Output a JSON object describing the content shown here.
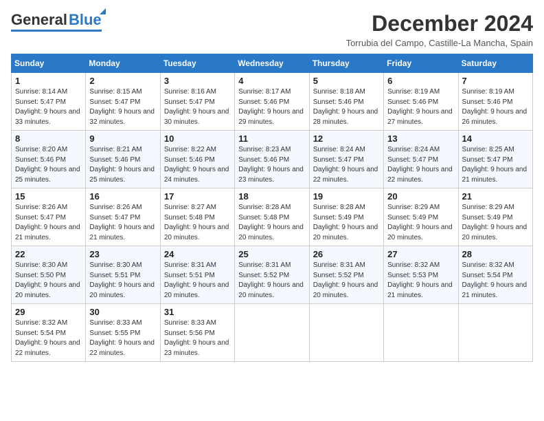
{
  "header": {
    "logo": {
      "general": "General",
      "blue": "Blue"
    },
    "title": "December 2024",
    "subtitle": "Torrubia del Campo, Castille-La Mancha, Spain"
  },
  "weekdays": [
    "Sunday",
    "Monday",
    "Tuesday",
    "Wednesday",
    "Thursday",
    "Friday",
    "Saturday"
  ],
  "weeks": [
    [
      {
        "day": "1",
        "sunrise": "8:14 AM",
        "sunset": "5:47 PM",
        "daylight": "9 hours and 33 minutes."
      },
      {
        "day": "2",
        "sunrise": "8:15 AM",
        "sunset": "5:47 PM",
        "daylight": "9 hours and 32 minutes."
      },
      {
        "day": "3",
        "sunrise": "8:16 AM",
        "sunset": "5:47 PM",
        "daylight": "9 hours and 30 minutes."
      },
      {
        "day": "4",
        "sunrise": "8:17 AM",
        "sunset": "5:46 PM",
        "daylight": "9 hours and 29 minutes."
      },
      {
        "day": "5",
        "sunrise": "8:18 AM",
        "sunset": "5:46 PM",
        "daylight": "9 hours and 28 minutes."
      },
      {
        "day": "6",
        "sunrise": "8:19 AM",
        "sunset": "5:46 PM",
        "daylight": "9 hours and 27 minutes."
      },
      {
        "day": "7",
        "sunrise": "8:19 AM",
        "sunset": "5:46 PM",
        "daylight": "9 hours and 26 minutes."
      }
    ],
    [
      {
        "day": "8",
        "sunrise": "8:20 AM",
        "sunset": "5:46 PM",
        "daylight": "9 hours and 25 minutes."
      },
      {
        "day": "9",
        "sunrise": "8:21 AM",
        "sunset": "5:46 PM",
        "daylight": "9 hours and 25 minutes."
      },
      {
        "day": "10",
        "sunrise": "8:22 AM",
        "sunset": "5:46 PM",
        "daylight": "9 hours and 24 minutes."
      },
      {
        "day": "11",
        "sunrise": "8:23 AM",
        "sunset": "5:46 PM",
        "daylight": "9 hours and 23 minutes."
      },
      {
        "day": "12",
        "sunrise": "8:24 AM",
        "sunset": "5:47 PM",
        "daylight": "9 hours and 22 minutes."
      },
      {
        "day": "13",
        "sunrise": "8:24 AM",
        "sunset": "5:47 PM",
        "daylight": "9 hours and 22 minutes."
      },
      {
        "day": "14",
        "sunrise": "8:25 AM",
        "sunset": "5:47 PM",
        "daylight": "9 hours and 21 minutes."
      }
    ],
    [
      {
        "day": "15",
        "sunrise": "8:26 AM",
        "sunset": "5:47 PM",
        "daylight": "9 hours and 21 minutes."
      },
      {
        "day": "16",
        "sunrise": "8:26 AM",
        "sunset": "5:47 PM",
        "daylight": "9 hours and 21 minutes."
      },
      {
        "day": "17",
        "sunrise": "8:27 AM",
        "sunset": "5:48 PM",
        "daylight": "9 hours and 20 minutes."
      },
      {
        "day": "18",
        "sunrise": "8:28 AM",
        "sunset": "5:48 PM",
        "daylight": "9 hours and 20 minutes."
      },
      {
        "day": "19",
        "sunrise": "8:28 AM",
        "sunset": "5:49 PM",
        "daylight": "9 hours and 20 minutes."
      },
      {
        "day": "20",
        "sunrise": "8:29 AM",
        "sunset": "5:49 PM",
        "daylight": "9 hours and 20 minutes."
      },
      {
        "day": "21",
        "sunrise": "8:29 AM",
        "sunset": "5:49 PM",
        "daylight": "9 hours and 20 minutes."
      }
    ],
    [
      {
        "day": "22",
        "sunrise": "8:30 AM",
        "sunset": "5:50 PM",
        "daylight": "9 hours and 20 minutes."
      },
      {
        "day": "23",
        "sunrise": "8:30 AM",
        "sunset": "5:51 PM",
        "daylight": "9 hours and 20 minutes."
      },
      {
        "day": "24",
        "sunrise": "8:31 AM",
        "sunset": "5:51 PM",
        "daylight": "9 hours and 20 minutes."
      },
      {
        "day": "25",
        "sunrise": "8:31 AM",
        "sunset": "5:52 PM",
        "daylight": "9 hours and 20 minutes."
      },
      {
        "day": "26",
        "sunrise": "8:31 AM",
        "sunset": "5:52 PM",
        "daylight": "9 hours and 20 minutes."
      },
      {
        "day": "27",
        "sunrise": "8:32 AM",
        "sunset": "5:53 PM",
        "daylight": "9 hours and 21 minutes."
      },
      {
        "day": "28",
        "sunrise": "8:32 AM",
        "sunset": "5:54 PM",
        "daylight": "9 hours and 21 minutes."
      }
    ],
    [
      {
        "day": "29",
        "sunrise": "8:32 AM",
        "sunset": "5:54 PM",
        "daylight": "9 hours and 22 minutes."
      },
      {
        "day": "30",
        "sunrise": "8:33 AM",
        "sunset": "5:55 PM",
        "daylight": "9 hours and 22 minutes."
      },
      {
        "day": "31",
        "sunrise": "8:33 AM",
        "sunset": "5:56 PM",
        "daylight": "9 hours and 23 minutes."
      },
      null,
      null,
      null,
      null
    ]
  ],
  "labels": {
    "sunrise": "Sunrise:",
    "sunset": "Sunset:",
    "daylight": "Daylight:"
  }
}
